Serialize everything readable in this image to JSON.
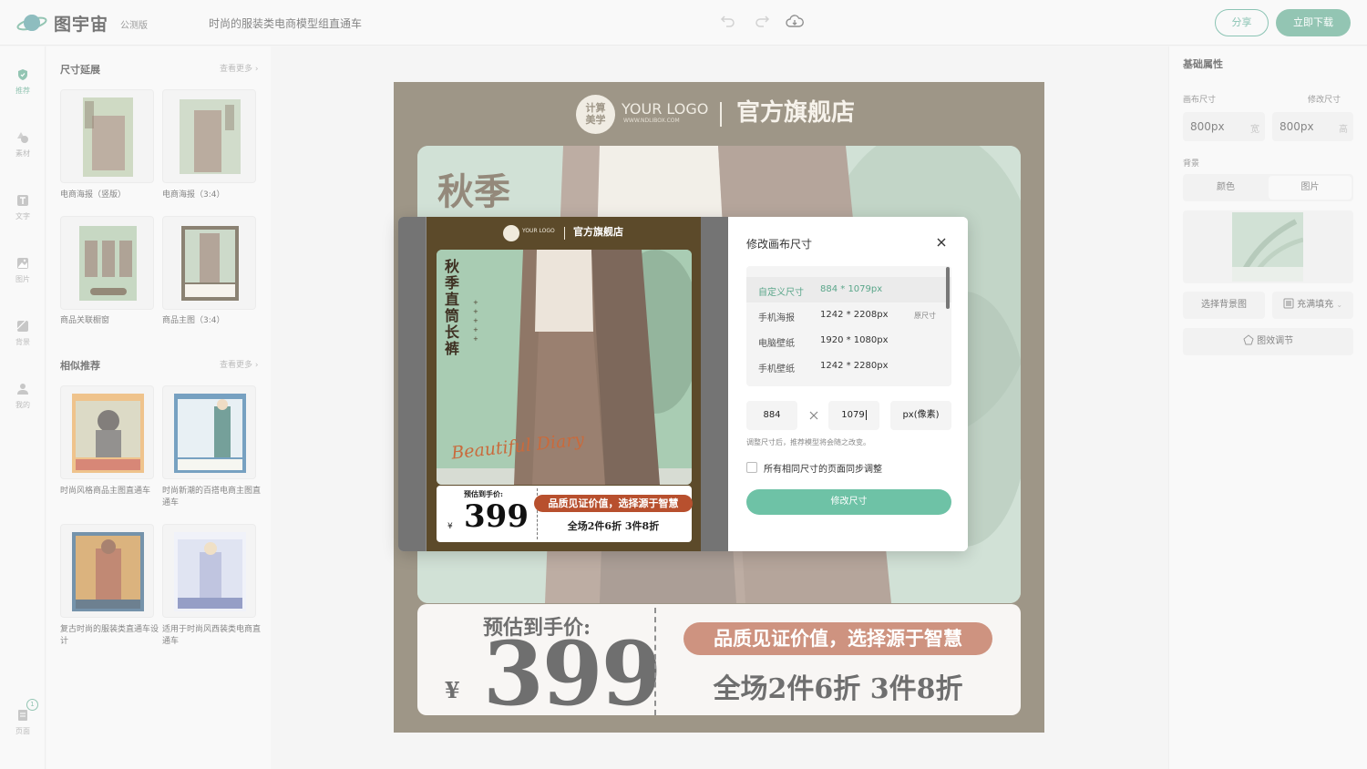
{
  "app": {
    "logo_text": "图宇宙",
    "beta": "公测版",
    "doc_title": "时尚的服装类电商模型组直通车",
    "share_label": "分享",
    "download_label": "立即下载",
    "accent": "#5aa68a"
  },
  "rail": {
    "items": [
      {
        "label": "推荐",
        "icon": "shield-icon"
      },
      {
        "label": "素材",
        "icon": "shapes-icon"
      },
      {
        "label": "文字",
        "icon": "text-icon"
      },
      {
        "label": "图片",
        "icon": "image-icon"
      },
      {
        "label": "背景",
        "icon": "background-icon"
      },
      {
        "label": "我的",
        "icon": "user-icon"
      }
    ],
    "pages_label": "页面",
    "page_count": "1"
  },
  "templates": {
    "section1_title": "尺寸延展",
    "section1_more": "查看更多",
    "section1_items": [
      "电商海报（竖版）",
      "电商海报（3:4）",
      "商品关联橱窗",
      "商品主图（3:4）"
    ],
    "section2_title": "相似推荐",
    "section2_more": "查看更多",
    "section2_items": [
      "时尚风格商品主图直通车",
      "时尚新潮的百搭电商主图直通车",
      "复古时尚的服装类直通车设计",
      "适用于时尚风西装类电商直通车"
    ]
  },
  "canvas": {
    "logo_circle": "计算\n美学",
    "logo_text": "YOUR LOGO",
    "logo_url": "WWW.NDLIBOX.COM",
    "store": "官方旗舰店",
    "title_char": "秋季",
    "price_label": "预估到手价:",
    "currency": "¥",
    "price": "399",
    "slogan": "品质见证价值，选择源于智慧",
    "promo": "全场2件6折 3件8折"
  },
  "poster_preview": {
    "logo_text": "YOUR LOGO",
    "store": "官方旗舰店",
    "vertical_title": "秋季直筒长裤",
    "script_text": "Beautiful Diary",
    "price_label": "预估到手价:",
    "currency": "¥",
    "price": "399",
    "slogan": "品质见证价值，选择源于智慧",
    "promo": "全场2件6折 3件8折"
  },
  "modal": {
    "title": "修改画布尺寸",
    "presets": [
      {
        "name": "自定义尺寸",
        "size": "884 * 1079px",
        "tag": ""
      },
      {
        "name": "手机海报",
        "size": "1242 * 2208px",
        "tag": "原尺寸"
      },
      {
        "name": "电脑壁纸",
        "size": "1920 * 1080px",
        "tag": ""
      },
      {
        "name": "手机壁纸",
        "size": "1242 * 2280px",
        "tag": ""
      }
    ],
    "width_value": "884",
    "height_value": "1079",
    "unit": "px(像素)",
    "hint": "调整尺寸后，推荐模型将会随之改变。",
    "sync_label": "所有相同尺寸的页面同步调整",
    "submit_label": "修改尺寸"
  },
  "props": {
    "title": "基础属性",
    "canvas_size_label": "画布尺寸",
    "modify_size_label": "修改尺寸",
    "width_value": "800px",
    "width_unit": "宽",
    "height_value": "800px",
    "height_unit": "高",
    "background_label": "背景",
    "tab_color": "颜色",
    "tab_image": "图片",
    "choose_bg_label": "选择背景图",
    "fill_label": "充满填充",
    "effect_label": "图效调节"
  }
}
